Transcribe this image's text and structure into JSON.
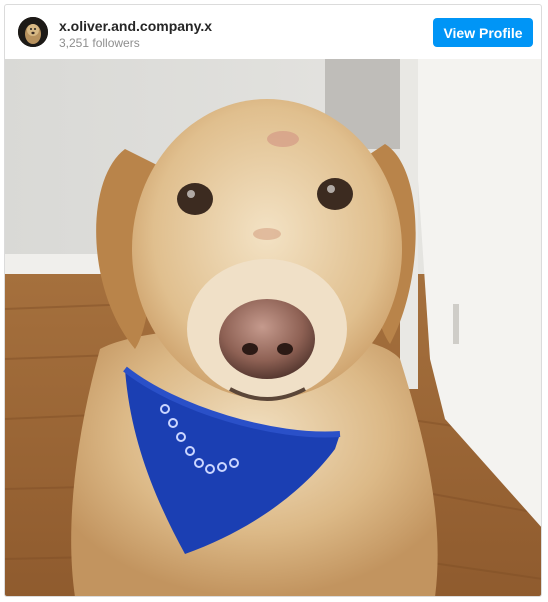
{
  "post": {
    "username": "x.oliver.and.company.x",
    "followers": "3,251 followers",
    "view_profile_label": "View Profile",
    "accent_color": "#0095f6"
  },
  "photo": {
    "subject": "golden-retriever-with-blue-bandana"
  }
}
